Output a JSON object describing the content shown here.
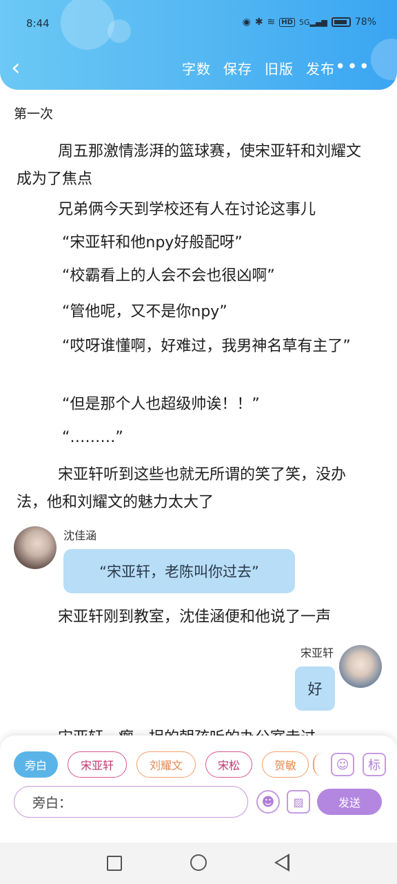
{
  "status_bar": {
    "time": "8:44",
    "network": "5G",
    "hd": "HD",
    "battery": "78%"
  },
  "toolbar": {
    "actions": [
      "字数",
      "保存",
      "旧版",
      "发布"
    ],
    "more": "•••"
  },
  "chapter": {
    "title": "第一次"
  },
  "paragraphs": [
    "周五那激情澎湃的篮球赛，使宋亚轩和刘耀文成为了焦点",
    "兄弟俩今天到学校还有人在讨论这事儿",
    "“宋亚轩和他npy好般配呀”",
    "“校霸看上的人会不会也很凶啊”",
    "“管他呢，又不是你npy”",
    "“哎呀谁懂啊，好难过，我男神名草有主了”",
    "“但是那个人也超级帅诶！！”",
    "“………”",
    "宋亚轩听到这些也就无所谓的笑了笑，没办法，他和刘耀文的魅力太大了"
  ],
  "chat": {
    "left": {
      "name": "沈佳涵",
      "text": "“宋亚轩，老陈叫你过去”"
    },
    "narration": "宋亚轩刚到教室，沈佳涵便和他说了一声",
    "right": {
      "name": "宋亚轩",
      "text": "好"
    },
    "cut_line": "宋亚轩一瘸一拐的朝孩听的办公室走过"
  },
  "composer": {
    "chips": [
      "旁白",
      "宋亚轩",
      "刘耀文",
      "宋松",
      "贺敏"
    ],
    "input_value": "旁白：",
    "send_label": "发送",
    "tag_label": "标"
  }
}
